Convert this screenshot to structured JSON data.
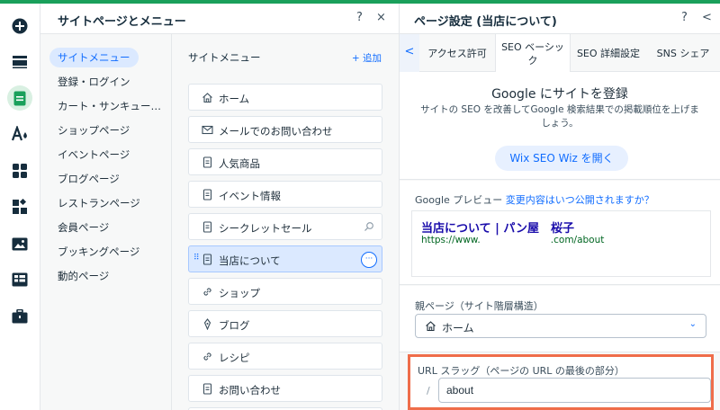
{
  "panel_left": {
    "title": "サイトページとメニュー",
    "help_icon": "?",
    "close_icon": "×",
    "categories": [
      "サイトメニュー",
      "登録・ログイン",
      "カート・サンキュー…",
      "ショップページ",
      "イベントページ",
      "ブログページ",
      "レストランページ",
      "会員ページ",
      "ブッキングページ",
      "動的ページ"
    ],
    "pages_header": "サイトメニュー",
    "add_label": "+ 追加",
    "pages": [
      {
        "label": "ホーム",
        "icon": "home-icon"
      },
      {
        "label": "メールでのお問い合わせ",
        "icon": "mail-icon"
      },
      {
        "label": "人気商品",
        "icon": "page-icon"
      },
      {
        "label": "イベント情報",
        "icon": "page-icon"
      },
      {
        "label": "シークレットセール",
        "icon": "page-icon"
      },
      {
        "label": "当店について",
        "icon": "page-icon"
      },
      {
        "label": "ショップ",
        "icon": "link-icon"
      },
      {
        "label": "ブログ",
        "icon": "pen-icon"
      },
      {
        "label": "レシピ",
        "icon": "link-icon"
      },
      {
        "label": "お問い合わせ",
        "icon": "page-icon"
      }
    ]
  },
  "panel_right": {
    "title": "ページ設定 (当店について)",
    "help_icon": "?",
    "back_icon": "<",
    "tabs": [
      "アクセス許可",
      "SEO ベーシック",
      "SEO 詳細設定",
      "SNS シェア"
    ],
    "google_title": "Google にサイトを登録",
    "google_desc": "サイトの SEO を改善してGoogle 検索結果での掲載順位を上げましょう。",
    "wiz_button": "Wix SEO Wiz を開く",
    "preview_label": "Google プレビュー",
    "preview_link": "変更内容はいつ公開されますか？",
    "preview_title": "当店について | パン屋　桜子",
    "preview_url_prefix": "https://www.",
    "preview_url_suffix": ".com/about",
    "parent_label": "親ページ（サイト階層構造）",
    "parent_value": "ホーム",
    "slug_label": "URL スラッグ（ページの URL の最後の部分）",
    "slug_prefix": "/",
    "slug_value": "about"
  },
  "colors": {
    "accent": "#116dff",
    "highlight": "#ef6d4a",
    "top_bar": "#1aa05b"
  }
}
